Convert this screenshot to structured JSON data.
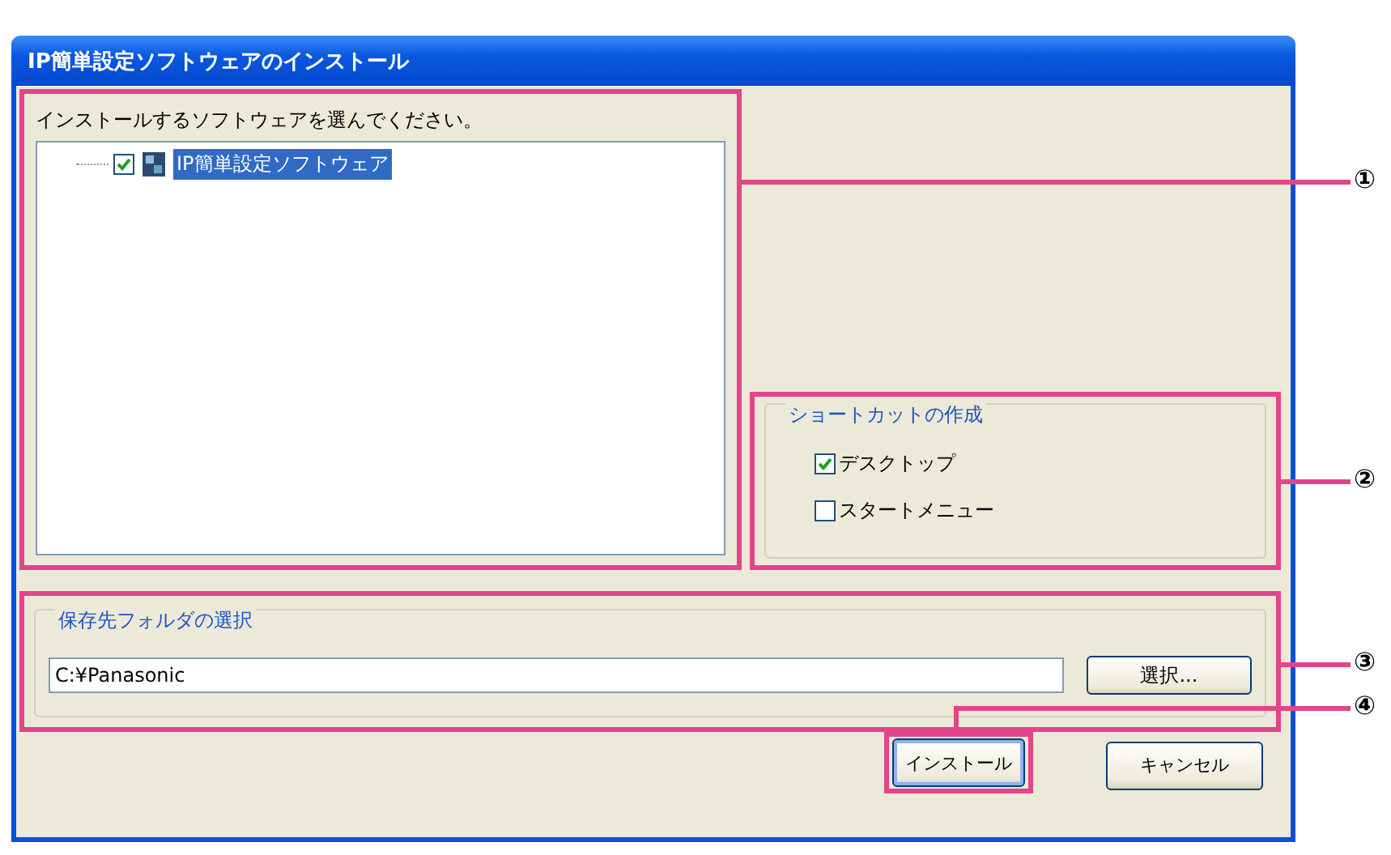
{
  "window": {
    "title": "IP簡単設定ソフトウェアのインストール"
  },
  "software_list": {
    "label": "インストールするソフトウェアを選んでください。",
    "items": [
      {
        "label": "IP簡単設定ソフトウェア",
        "checked": true,
        "selected": true
      }
    ]
  },
  "shortcuts": {
    "legend": "ショートカットの作成",
    "options": [
      {
        "label": "デスクトップ",
        "checked": true
      },
      {
        "label": "スタートメニュー",
        "checked": false
      }
    ]
  },
  "folder": {
    "legend": "保存先フォルダの選択",
    "value": "C:¥Panasonic",
    "browse_button": "選択..."
  },
  "buttons": [
    {
      "label": "インストール",
      "focused": true
    },
    {
      "label": "キャンセル",
      "focused": false
    }
  ],
  "callouts": [
    "①",
    "②",
    "③",
    "④"
  ]
}
